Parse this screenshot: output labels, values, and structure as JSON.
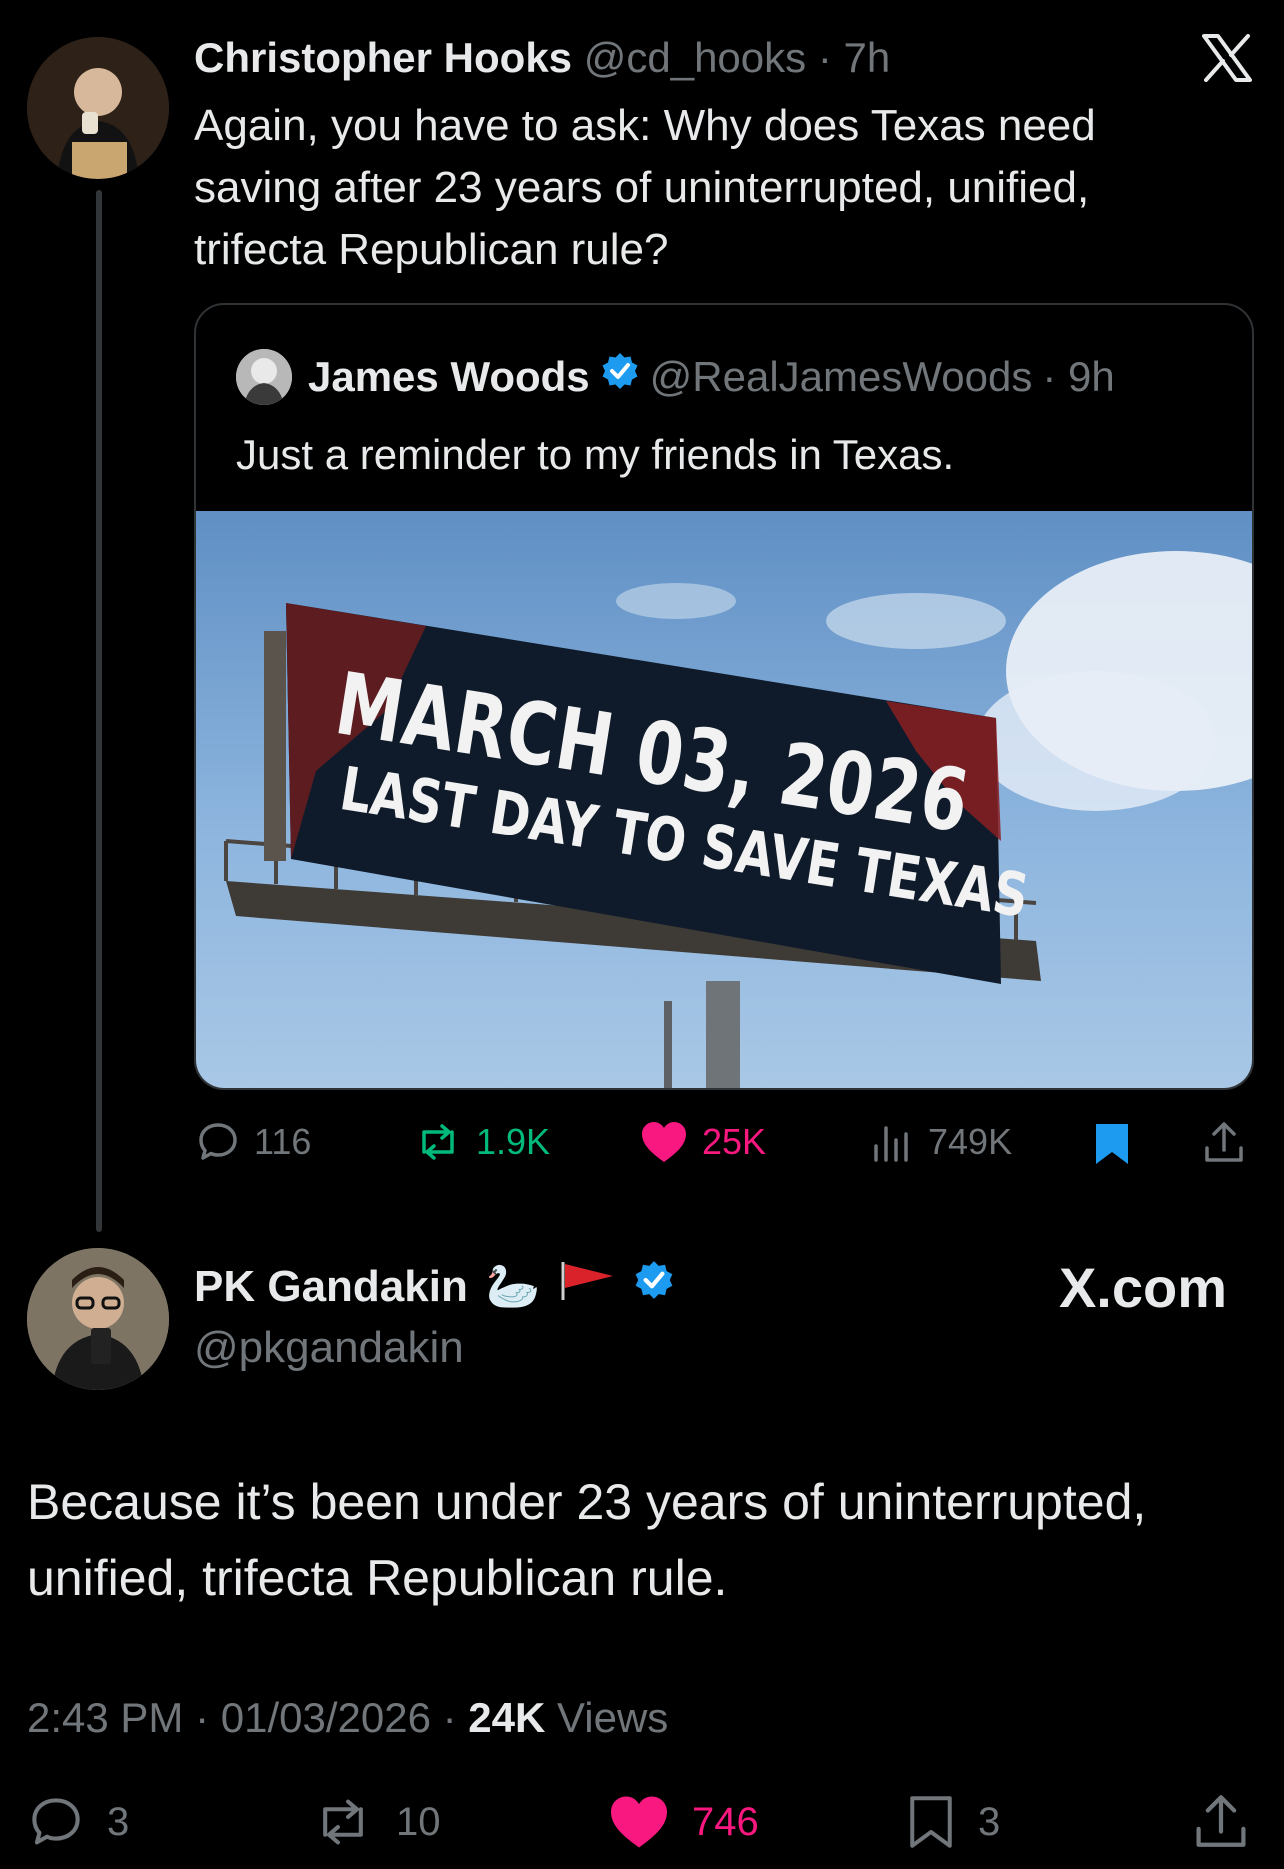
{
  "thread": {
    "parent": {
      "display_name": "Christopher Hooks",
      "handle": "@cd_hooks",
      "time": "· 7h",
      "text": "Again, you have to ask: Why does Texas need saving after 23 years of uninterrupted, unified, trifecta Republican rule?",
      "brand_icon": "x-logo-icon"
    },
    "quoted": {
      "display_name": "James Woods",
      "handle": "@RealJamesWoods",
      "time": "· 9h",
      "text": "Just a reminder to my friends in Texas.",
      "billboard": {
        "line1": "MARCH 03, 2026",
        "line2": "LAST DAY TO SAVE TEXAS"
      }
    },
    "parent_stats": {
      "replies": "116",
      "reposts": "1.9K",
      "likes": "25K",
      "views": "749K"
    }
  },
  "main": {
    "display_name": "PK Gandakin",
    "emoji": "🦢",
    "handle": "@pkgandakin",
    "brand_text": "X.com",
    "text": "Because it’s been under 23 years of uninterrupted, unified, trifecta Republican rule.",
    "time": "2:43 PM",
    "date": "01/03/2026",
    "views_count": "24K",
    "views_label": "Views",
    "stats": {
      "replies": "3",
      "reposts": "10",
      "likes": "746",
      "bookmarks": "3"
    }
  },
  "colors": {
    "background": "#000000",
    "text": "#e7e9ea",
    "muted": "#71767b",
    "verified": "#1d9bf0",
    "like": "#f91880",
    "repost": "#00ba7c"
  }
}
